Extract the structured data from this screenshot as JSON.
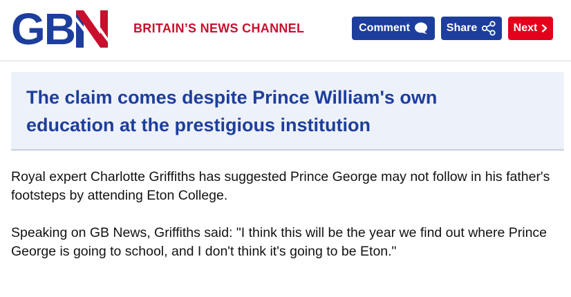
{
  "header": {
    "logo": {
      "text": "GBN",
      "letters_left": "GB",
      "letter_right": "N"
    },
    "tagline": "BRITAIN’S NEWS CHANNEL",
    "buttons": {
      "comment_label": "Comment",
      "share_label": "Share",
      "next_label": "Next"
    },
    "colors": {
      "brand_blue": "#1d3e9c",
      "brand_red": "#c8102e",
      "next_red": "#e3001b"
    }
  },
  "standfirst": {
    "text": "The claim comes despite Prince William's own education at the prestigious institution"
  },
  "article": {
    "paragraphs": [
      "Royal expert Charlotte Griffiths has suggested Prince George may not follow in his father's footsteps by attending Eton College.",
      "Speaking on GB News, Griffiths said: \"I think this will be the year we find out where Prince George is going to school, and I don't think it's going to be Eton.\""
    ]
  },
  "icons": {
    "comment": "speech-bubble-icon",
    "share": "share-nodes-icon",
    "next": "chevron-right-icon"
  }
}
